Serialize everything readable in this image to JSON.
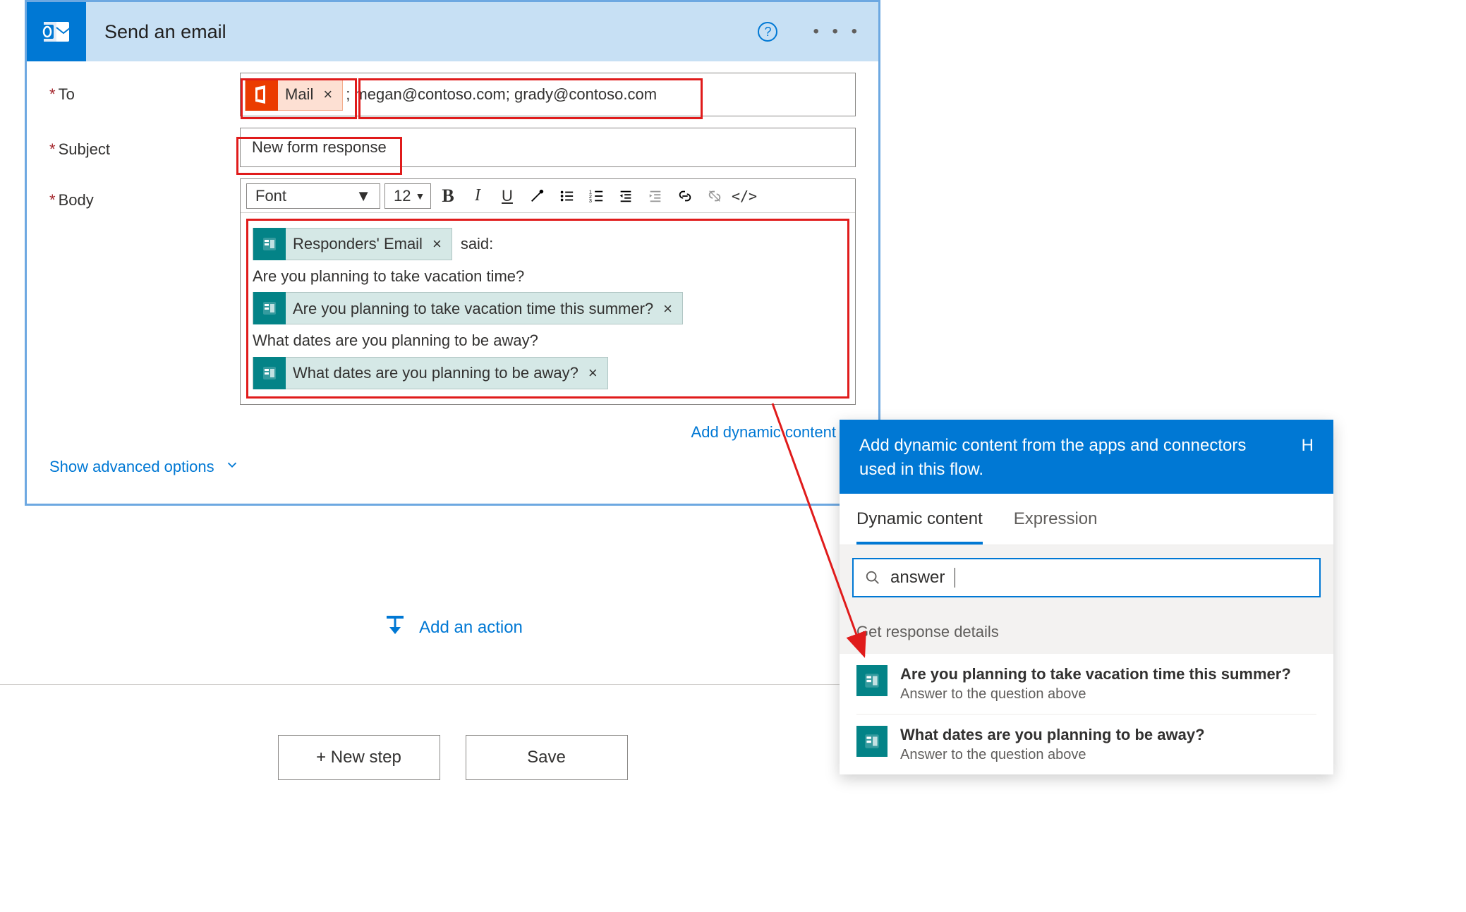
{
  "card": {
    "title": "Send an email",
    "help": "?",
    "fields": {
      "to_label": "To",
      "subject_label": "Subject",
      "body_label": "Body"
    },
    "to": {
      "chip_label": "Mail",
      "value": "; megan@contoso.com; grady@contoso.com"
    },
    "subject": {
      "value": "New form response"
    },
    "body": {
      "toolbar": {
        "font_label": "Font",
        "size_label": "12"
      },
      "tokens": {
        "responders_email": "Responders' Email",
        "said": "said:",
        "q1_text": "Are you planning to take vacation time?",
        "q1_token": "Are you planning to take vacation time this summer?",
        "q2_text": "What dates are you planning to be away?",
        "q2_token": "What dates are you planning to be away?"
      }
    },
    "dyn_link": "Add dynamic content",
    "adv_link": "Show advanced options"
  },
  "add_action": "Add an action",
  "buttons": {
    "new_step": "+ New step",
    "save": "Save"
  },
  "flyout": {
    "head": "Add dynamic content from the apps and connectors used in this flow.",
    "hide": "H",
    "tab_dynamic": "Dynamic content",
    "tab_expr": "Expression",
    "search_value": "answer",
    "section": "Get response details",
    "items": [
      {
        "title": "Are you planning to take vacation time this summer?",
        "sub": "Answer to the question above"
      },
      {
        "title": "What dates are you planning to be away?",
        "sub": "Answer to the question above"
      }
    ]
  }
}
